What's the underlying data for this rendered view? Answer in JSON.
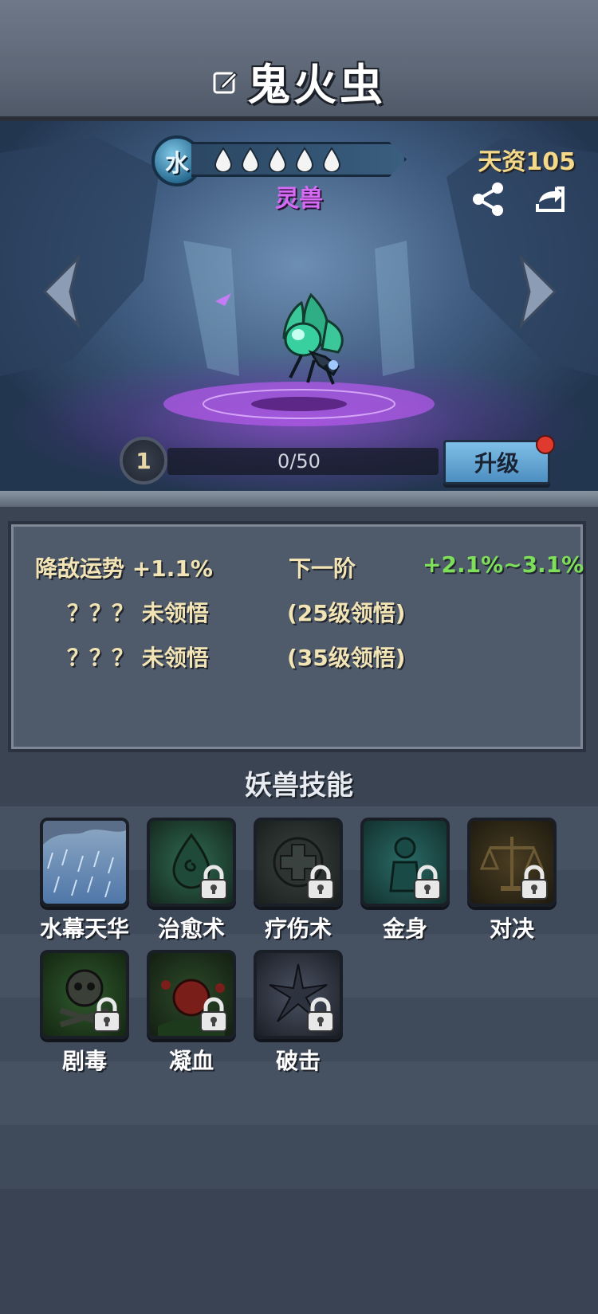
{
  "header": {
    "title": "鬼火虫"
  },
  "pet": {
    "element": "水",
    "rank": "灵兽",
    "aptitude": "天资105",
    "level": "1",
    "xp": "0/50",
    "star_drops": 5
  },
  "buttons": {
    "upgrade": "升级"
  },
  "stats": {
    "row1_label": "降敌运势",
    "row1_value": "+1.1%",
    "next_label": "下一阶",
    "next_value": "+2.1%~3.1%",
    "row2_label": "？？？ 未领悟",
    "row2_hint": "(25级领悟)",
    "row3_label": "？？？ 未领悟",
    "row3_hint": "(35级领悟)"
  },
  "skills_title": "妖兽技能",
  "skills": [
    {
      "name": "水幕天华",
      "locked": false,
      "icon": "rain-icon"
    },
    {
      "name": "治愈术",
      "locked": true,
      "icon": "heal-drop-icon"
    },
    {
      "name": "疗伤术",
      "locked": true,
      "icon": "cross-icon"
    },
    {
      "name": "金身",
      "locked": true,
      "icon": "golden-body-icon"
    },
    {
      "name": "对决",
      "locked": true,
      "icon": "scales-icon"
    },
    {
      "name": "剧毒",
      "locked": true,
      "icon": "skull-icon"
    },
    {
      "name": "凝血",
      "locked": true,
      "icon": "blood-apple-icon"
    },
    {
      "name": "破击",
      "locked": true,
      "icon": "shatter-icon"
    }
  ]
}
